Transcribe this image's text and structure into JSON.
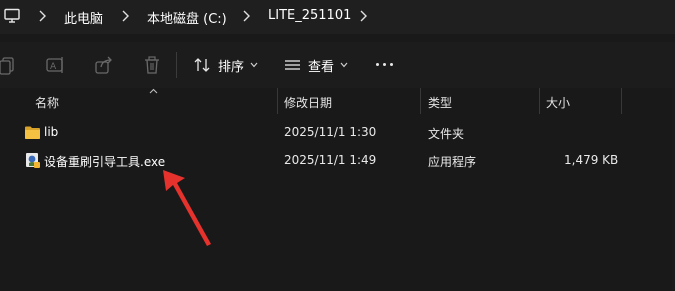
{
  "breadcrumb": {
    "items": [
      "此电脑",
      "本地磁盘 (C:)",
      "LITE_251101"
    ]
  },
  "toolbar": {
    "icons": [
      "copy-icon",
      "rename-icon",
      "share-icon",
      "delete-icon"
    ],
    "sort_label": "排序",
    "view_label": "查看",
    "more_label": "..."
  },
  "columns": {
    "name": "名称",
    "date": "修改日期",
    "type": "类型",
    "size": "大小"
  },
  "rows": [
    {
      "name": "lib",
      "date": "2025/11/1 1:30",
      "type": "文件夹",
      "size": "",
      "icon": "folder-icon"
    },
    {
      "name": "设备重刷引导工具.exe",
      "date": "2025/11/1 1:49",
      "type": "应用程序",
      "size": "1,479 KB",
      "icon": "app-icon"
    }
  ],
  "colors": {
    "background": "#191919",
    "folder": "#f4c143",
    "annotation_arrow": "#e5322d"
  }
}
